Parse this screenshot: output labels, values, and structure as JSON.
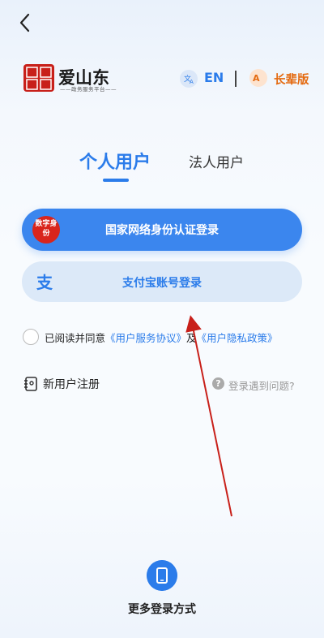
{
  "header": {
    "back_icon": "chevron-left-icon",
    "brand_name": "爱山东",
    "brand_subtitle": "——政务服务平台——",
    "language_label": "EN",
    "elder_mode_label": "长辈版"
  },
  "tabs": {
    "personal": "个人用户",
    "legal": "法人用户"
  },
  "login": {
    "id_badge_text": "数字身份",
    "id_button": "国家网络身份认证登录",
    "alipay_button": "支付宝账号登录"
  },
  "agreement": {
    "prefix": "已阅读并同意",
    "service_link": "《用户服务协议》",
    "conjunction": "及",
    "privacy_link": "《用户隐私政策》"
  },
  "register_label": "新用户注册",
  "help_label": "登录遇到问题?",
  "more_login_label": "更多登录方式",
  "colors": {
    "accent": "#2b7cea",
    "elder": "#e46a10",
    "arrow": "#c8201a"
  }
}
